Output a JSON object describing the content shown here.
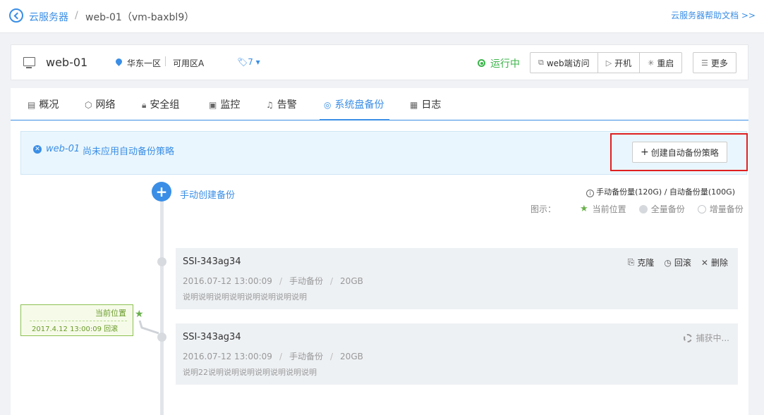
{
  "breadcrumb": {
    "root": "云服务器",
    "separator": "/",
    "current": "web-01（vm-baxbl9）"
  },
  "help_link": "云服务器帮助文档 >>",
  "instance": {
    "name": "web-01",
    "region": "华东一区",
    "zone": "可用区A",
    "tag_count": "7 ▾",
    "status": "运行中",
    "status_color": "#3cb44b",
    "actions": [
      {
        "label": "web端访问",
        "icon": "web-terminal-icon"
      },
      {
        "label": "开机",
        "icon": "play-icon"
      },
      {
        "label": "重启",
        "icon": "restart-icon"
      }
    ],
    "more_label": "更多"
  },
  "tabs": [
    {
      "label": "概况",
      "icon": "overview-icon"
    },
    {
      "label": "网络",
      "icon": "network-icon"
    },
    {
      "label": "安全组",
      "icon": "lock-icon"
    },
    {
      "label": "监控",
      "icon": "monitor-icon"
    },
    {
      "label": "告警",
      "icon": "bell-icon"
    },
    {
      "label": "系统盘备份",
      "icon": "camera-icon",
      "active": true
    },
    {
      "label": "日志",
      "icon": "log-icon"
    }
  ],
  "notice": {
    "instance_name": "web-01",
    "text": "尚未应用自动备份策略",
    "create_button": "创建自动备份策略"
  },
  "timeline": {
    "add_label": "手动创建备份",
    "quota_text": "手动备份量(120G) / 自动备份量(100G)",
    "legend": {
      "label": "图示：",
      "current": "当前位置",
      "full": "全量备份",
      "incremental": "增量备份"
    },
    "current_position": {
      "title": "当前位置",
      "detail": "2017.4.12 13:00:09 回滚"
    },
    "backups": [
      {
        "name": "SSI-343ag34",
        "time": "2016.07-12 13:00:09",
        "type": "手动备份",
        "size": "20GB",
        "description": "说明说明说明说明说明说明说明说明",
        "actions": [
          "克隆",
          "回滚",
          "删除"
        ]
      },
      {
        "name": "SSI-343ag34",
        "time": "2016.07-12 13:00:09",
        "type": "手动备份",
        "size": "20GB",
        "description": "说明22说明说明说明说明说明说明说明",
        "capturing_label": "捕获中..."
      }
    ]
  },
  "colors": {
    "accent": "#3a8ee6",
    "highlight_border": "#e02020",
    "current_position": "#6ab04c"
  }
}
